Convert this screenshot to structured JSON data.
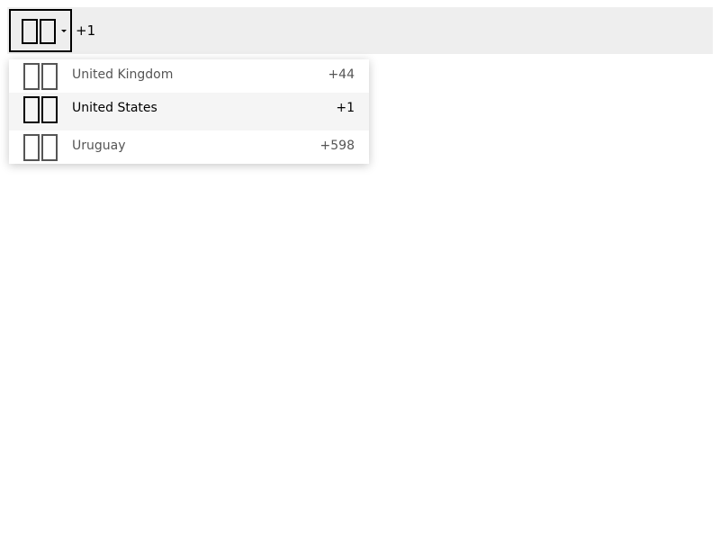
{
  "phone_input": {
    "selected_flag_icon": "us-flag-icon",
    "dial_code": "+1"
  },
  "country_dropdown": {
    "options": [
      {
        "flag_icon": "gb-flag-icon",
        "name": "United Kingdom",
        "code": "+44",
        "selected": false
      },
      {
        "flag_icon": "us-flag-icon",
        "name": "United States",
        "code": "+1",
        "selected": true
      },
      {
        "flag_icon": "uy-flag-icon",
        "name": "Uruguay",
        "code": "+598",
        "selected": false
      }
    ]
  },
  "colors": {
    "bar_background": "#eeeeee",
    "selected_row": "#f5f5f5",
    "muted_text": "#555555"
  }
}
